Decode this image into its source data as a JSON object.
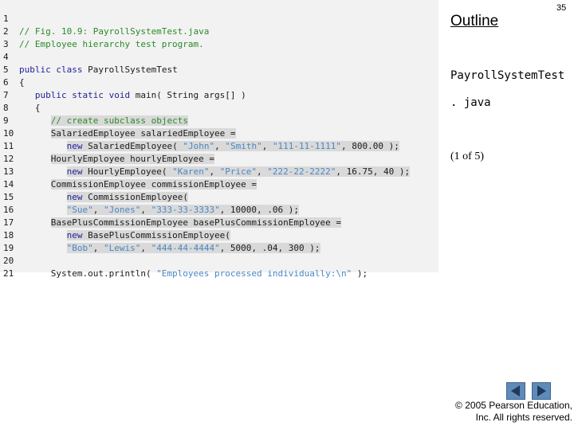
{
  "slide": {
    "outline_label": "Outline",
    "page_number": "35",
    "file_title": "PayrollSystemTest",
    "file_ext": ". java",
    "page_count": "(1 of 5)",
    "copyright_line1": "© 2005 Pearson Education,",
    "copyright_line2": "Inc. All rights reserved."
  },
  "code": {
    "lines": [
      {
        "n": "1"
      },
      {
        "n": "2"
      },
      {
        "n": "3"
      },
      {
        "n": "4"
      },
      {
        "n": "5"
      },
      {
        "n": "6"
      },
      {
        "n": "7"
      },
      {
        "n": "8"
      },
      {
        "n": "9"
      },
      {
        "n": "10"
      },
      {
        "n": "11"
      },
      {
        "n": "12"
      },
      {
        "n": "13"
      },
      {
        "n": "14"
      },
      {
        "n": "15"
      },
      {
        "n": "16"
      },
      {
        "n": "17"
      },
      {
        "n": "18"
      },
      {
        "n": "19"
      },
      {
        "n": "20"
      },
      {
        "n": "21"
      }
    ],
    "t": {
      "l1": "// Fig. 10.9: PayrollSystemTest.java",
      "l2": "// Employee hierarchy test program.",
      "l4_kw": "public class",
      "l4_rest": " PayrollSystemTest",
      "l5": "{",
      "l6_kw": "   public static void",
      "l6_rest": " main( String args[] )",
      "l7": "   {",
      "l8_indent": "      ",
      "l8": "// create subclass objects",
      "l9_indent": "      ",
      "l9": "SalariedEmployee salariedEmployee =",
      "l10_indent": "         ",
      "l10_kw": "new",
      "l10_a": " SalariedEmployee( ",
      "l10_s1": "\"John\"",
      "l10_c1": ", ",
      "l10_s2": "\"Smith\"",
      "l10_c2": ", ",
      "l10_s3": "\"111-11-1111\"",
      "l10_end": ", 800.00 );",
      "l11_indent": "      ",
      "l11": "HourlyEmployee hourlyEmployee =",
      "l12_indent": "         ",
      "l12_kw": "new",
      "l12_a": " HourlyEmployee( ",
      "l12_s1": "\"Karen\"",
      "l12_c1": ", ",
      "l12_s2": "\"Price\"",
      "l12_c2": ", ",
      "l12_s3": "\"222-22-2222\"",
      "l12_end": ", 16.75, 40 );",
      "l13_indent": "      ",
      "l13": "CommissionEmployee commissionEmployee =",
      "l14_indent": "         ",
      "l14_kw": "new",
      "l14_a": " CommissionEmployee(",
      "l15_indent": "         ",
      "l15_s1": "\"Sue\"",
      "l15_c1": ", ",
      "l15_s2": "\"Jones\"",
      "l15_c2": ", ",
      "l15_s3": "\"333-33-3333\"",
      "l15_end": ", 10000, .06 );",
      "l16_indent": "      ",
      "l16": "BasePlusCommissionEmployee basePlusCommissionEmployee =",
      "l17_indent": "         ",
      "l17_kw": "new",
      "l17_a": " BasePlusCommissionEmployee(",
      "l18_indent": "         ",
      "l18_s1": "\"Bob\"",
      "l18_c1": ", ",
      "l18_s2": "\"Lewis\"",
      "l18_c2": ", ",
      "l18_s3": "\"444-44-4444\"",
      "l18_end": ", 5000, .04, 300 );",
      "l20_a": "      System.out.println( ",
      "l20_s": "\"Employees processed individually:\\n\"",
      "l20_end": " );"
    }
  },
  "colors": {
    "code_bg": "#f2f2f2",
    "highlight": "#d9d9d9",
    "comment": "#2a8a2a",
    "keyword": "#1f1f99",
    "string": "#4a87c4",
    "nav_button": "#5f8bb8"
  },
  "icons": {
    "prev": "left-arrow-icon",
    "next": "right-arrow-icon"
  }
}
